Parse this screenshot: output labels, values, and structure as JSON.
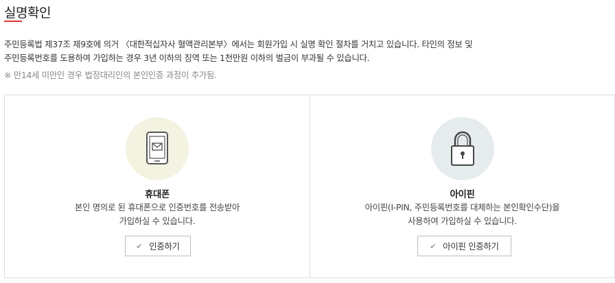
{
  "page": {
    "title": "실명확인",
    "description_lines": [
      "주민등록법 제37조 제9호에 의거 〈대한적십자사 혈액관리본부〉에서는 회원가입 시 실명 확인 절차를 거치고 있습니다. 타인의 정보 및",
      "주민등록번호를 도용하여 가입하는 경우 3년 이하의 징역 또는 1천만원 이하의 벌금이 부과될 수 있습니다."
    ],
    "note": "※ 만14세 미만인 경우 법정대리인의 본인인증 과정이 추가됨."
  },
  "options": {
    "phone": {
      "icon": "mobile-phone-mail-icon",
      "title": "휴대폰",
      "desc_lines": [
        "본인 명의로 된 휴대폰으로 인증번호를 전송받아",
        "가입하실 수 있습니다."
      ],
      "button_label": "인증하기"
    },
    "ipin": {
      "icon": "padlock-icon",
      "title": "아이핀",
      "desc_lines": [
        "아이핀(I-PIN, 주민등록번호를 대체하는 본인확인수단)을",
        "사용하여 가입하실 수 있습니다."
      ],
      "button_label": "아이핀 인증하기"
    }
  },
  "colors": {
    "accent": "#e5322d",
    "phone_circle": "#f4f3e2",
    "ipin_circle": "#e6ecee",
    "border": "#dcdcdc"
  }
}
